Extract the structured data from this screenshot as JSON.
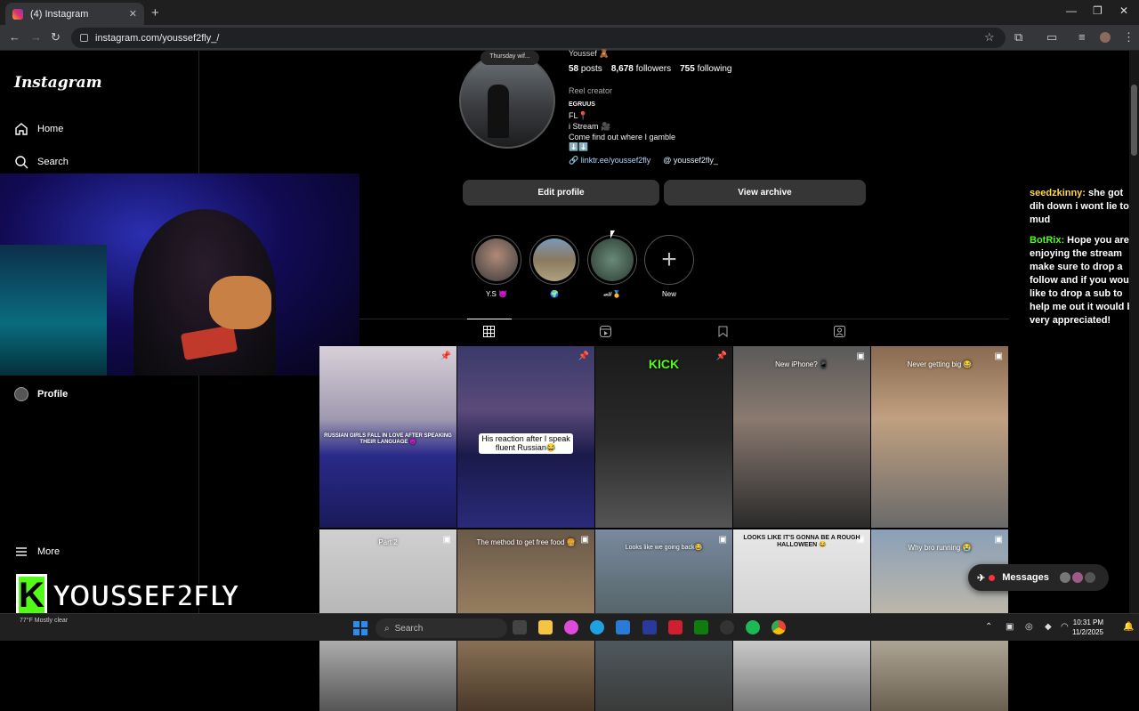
{
  "browser": {
    "tab_title": "(4) Instagram",
    "new_tab": "+",
    "url": "instagram.com/youssef2fly_/",
    "window_controls": [
      "—",
      "❐",
      "✕"
    ]
  },
  "sidebar": {
    "logo": "Instagram",
    "items": [
      {
        "label": "Home",
        "icon": "home-icon"
      },
      {
        "label": "Search",
        "icon": "search-icon"
      },
      {
        "label": "Profile",
        "icon": "profile-avatar"
      },
      {
        "label": "More",
        "icon": "menu-icon"
      }
    ]
  },
  "overlay": {
    "brand_letter": "K",
    "brand_name": "YOUSSEF2FLY"
  },
  "profile": {
    "note": "Thursday wif...",
    "username_partial": "Youssef 🧸",
    "posts": "58",
    "posts_label": "posts",
    "followers": "8,678",
    "followers_label": "followers",
    "following": "755",
    "following_label": "following",
    "category": "Reel creator",
    "bio_lines": [
      "EGRUUS",
      "FL📍",
      "i Stream 🎥",
      "Come find out where I gamble",
      "⬇️⬇️"
    ],
    "link": "linktr.ee/youssef2fly",
    "threads": "youssef2fly_",
    "edit_button": "Edit profile",
    "archive_button": "View archive"
  },
  "highlights": [
    {
      "caption": "Y.S 👿",
      "color": "#8a7a6a"
    },
    {
      "caption": "🌍",
      "color": "#9a8a70"
    },
    {
      "caption": "🏎🥇",
      "color": "#4a6a5a"
    },
    {
      "caption": "New",
      "color": ""
    }
  ],
  "posts": [
    {
      "caption": "RUSSIAN GIRLS FALL IN LOVE AFTER SPEAKING THEIR LANGUAGE 😈",
      "pinned": true
    },
    {
      "caption": "His reaction after I speak fluent Russian😂",
      "pinned": true
    },
    {
      "caption": "KICK",
      "pinned": true
    },
    {
      "caption": "New iPhone? 📱",
      "pinned": false
    },
    {
      "caption": "Never getting big 😂",
      "pinned": false
    },
    {
      "caption": "Part 2",
      "pinned": false
    },
    {
      "caption": "The method to get free food 🍔",
      "pinned": false
    },
    {
      "caption": "Looks like we going back😂",
      "pinned": false
    },
    {
      "caption": "LOOKS LIKE IT'S GONNA BE A ROUGH HALLOWEEN 😂",
      "pinned": false
    },
    {
      "caption": "Why bro running 😭",
      "pinned": false
    }
  ],
  "chat": {
    "msg1_user": "seedzkinny:",
    "msg1_text": "she got dih down i wont lie to u mud",
    "msg2_user": "BotRix:",
    "msg2_text": "Hope you are enjoying the stream make sure to drop a follow and if you would like to drop a sub to help me out it would be very appreciated!"
  },
  "messages_button": "Messages",
  "messages_badge": "4",
  "taskbar": {
    "weather": "77°F Mostly clear",
    "search_placeholder": "Search",
    "time": "10:31 PM",
    "date": "11/2/2025"
  }
}
